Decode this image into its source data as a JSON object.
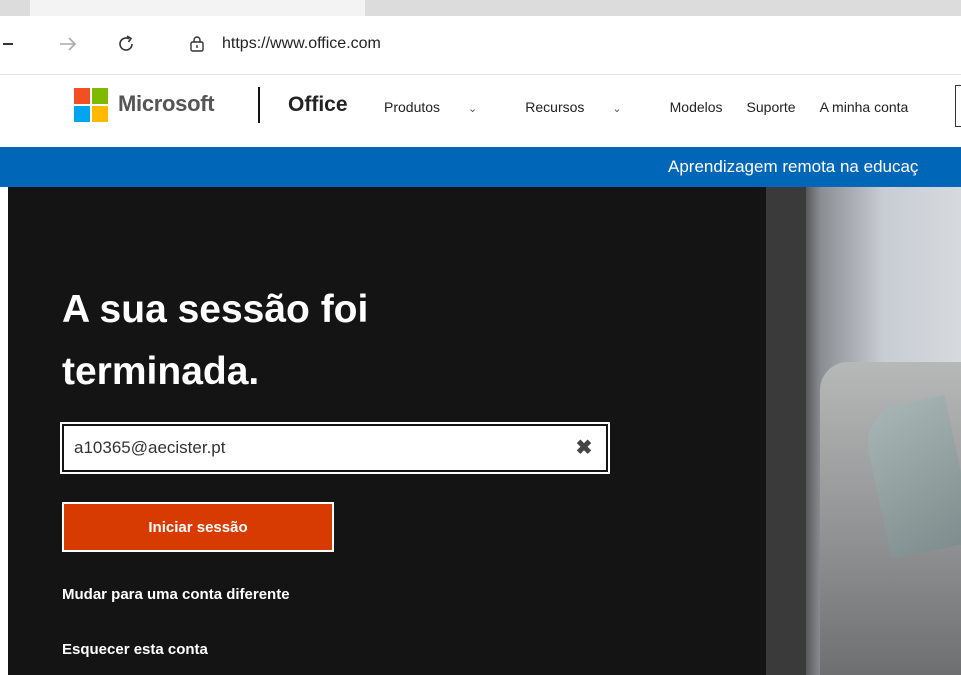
{
  "browser": {
    "url": "https://www.office.com",
    "back_icon": "back-arrow-icon",
    "forward_icon": "forward-arrow-icon",
    "refresh_icon": "refresh-icon",
    "lock_icon": "lock-icon"
  },
  "header": {
    "brand": "Microsoft",
    "product": "Office",
    "nav": [
      {
        "label": "Produtos",
        "has_dropdown": true
      },
      {
        "label": "Recursos",
        "has_dropdown": true
      },
      {
        "label": "Modelos",
        "has_dropdown": false
      },
      {
        "label": "Suporte",
        "has_dropdown": false
      },
      {
        "label": "A minha conta",
        "has_dropdown": false
      }
    ],
    "logo_colors": [
      "#f25022",
      "#7fba00",
      "#00a4ef",
      "#ffb900"
    ]
  },
  "banner": {
    "text": "Aprendizagem remota na educaç",
    "color": "#0067b8"
  },
  "hero": {
    "headline_line1": "A sua sessão foi",
    "headline_line2": "terminada.",
    "email_value": "a10365@aecister.pt",
    "signin_label": "Iniciar sessão",
    "switch_account_label": "Mudar para uma conta diferente",
    "forget_account_label": "Esquecer esta conta",
    "accent": "#d83b01"
  }
}
